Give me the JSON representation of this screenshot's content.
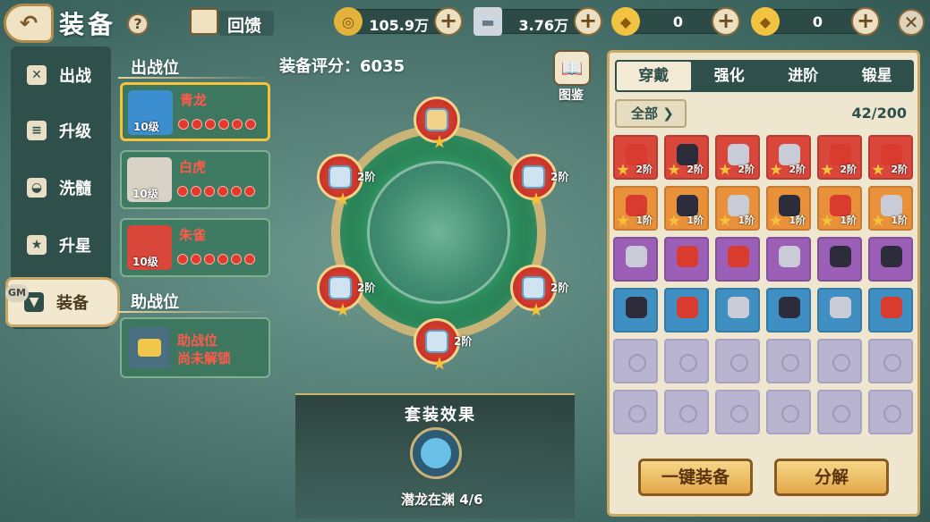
{
  "header": {
    "title": "装备",
    "help": "?",
    "gift_label": "回馈",
    "resources": [
      {
        "name": "coin",
        "value": "105.9万",
        "color": "#e2b23a"
      },
      {
        "name": "silver",
        "value": "3.76万",
        "color": "#cfd6de"
      },
      {
        "name": "gold-ingot",
        "value": "0",
        "color": "#f2c340"
      },
      {
        "name": "gold-ingot-2",
        "value": "0",
        "color": "#f2c340"
      }
    ],
    "plus": "+",
    "close": "✕"
  },
  "nav": {
    "items": [
      {
        "label": "出战",
        "icon": "swords-icon"
      },
      {
        "label": "升级",
        "icon": "list-icon"
      },
      {
        "label": "洗髓",
        "icon": "helmet-icon"
      },
      {
        "label": "升星",
        "icon": "star-icon"
      },
      {
        "label": "装备",
        "icon": "anvil-icon"
      }
    ],
    "active": "装备",
    "gm": "GM"
  },
  "battle": {
    "title": "出战位",
    "heroes": [
      {
        "name": "青龙",
        "level": "10级",
        "stars": 6,
        "color": "#3b8fd0"
      },
      {
        "name": "白虎",
        "level": "10级",
        "stars": 6,
        "color": "#d8d3c6"
      },
      {
        "name": "朱雀",
        "level": "10级",
        "stars": 6,
        "color": "#d9463a"
      }
    ],
    "assist_title": "助战位",
    "assist_text1": "助战位",
    "assist_text2": "尚未解锁"
  },
  "center": {
    "score": "装备评分：6035",
    "book_label": "图鉴",
    "slots": [
      {
        "tier": "",
        "stars": "1"
      },
      {
        "tier": "2阶",
        "stars": "1"
      },
      {
        "tier": "2阶",
        "stars": "1"
      },
      {
        "tier": "2阶",
        "stars": "1"
      },
      {
        "tier": "2阶",
        "stars": "1"
      },
      {
        "tier": "2阶",
        "stars": "1"
      }
    ],
    "set_title": "套装效果",
    "set_level": "5",
    "set_label": "潜龙在渊 4/6"
  },
  "panel": {
    "tabs": [
      "穿戴",
      "强化",
      "进阶",
      "锻星"
    ],
    "active_tab": "穿戴",
    "filter": "全部",
    "count": "42/200",
    "rows": [
      {
        "bg": "#d9463a",
        "tier": "2阶",
        "items": [
          "#d93b2e",
          "#2c2c3a",
          "#c9ccd6",
          "#c9ccd6",
          "#d93b2e",
          "#d93b2e"
        ]
      },
      {
        "bg": "#e8913a",
        "tier": "1阶",
        "items": [
          "#d93b2e",
          "#2c2c3a",
          "#c9ccd6",
          "#2c2c3a",
          "#d93b2e",
          "#c9ccd6"
        ]
      },
      {
        "bg": "#9b5fb8",
        "tier": "",
        "items": [
          "#c9ccd6",
          "#d93b2e",
          "#d93b2e",
          "#c9ccd6",
          "#2c2c3a",
          "#2c2c3a"
        ]
      },
      {
        "bg": "#3f8fc3",
        "tier": "",
        "items": [
          "#2c2c3a",
          "#d93b2e",
          "#c9ccd6",
          "#2c2c3a",
          "#c9ccd6",
          "#d93b2e"
        ]
      }
    ],
    "empty_rows": 2,
    "btn_equip": "一键装备",
    "btn_decompose": "分解"
  }
}
